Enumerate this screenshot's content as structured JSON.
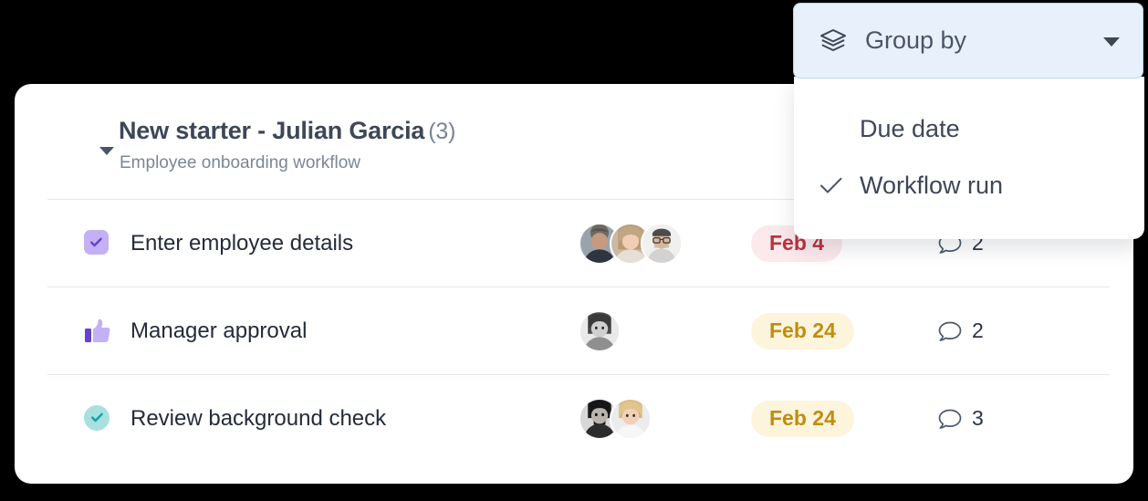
{
  "group_by_control": {
    "label": "Group by",
    "icon": "layers-icon",
    "caret_icon": "chevron-down-icon",
    "background": "#e8f1fb",
    "border": "#b9d3ee",
    "menu": {
      "items": [
        {
          "label": "Due date",
          "checked": false
        },
        {
          "label": "Workflow run",
          "checked": true
        }
      ],
      "check_icon": "check-icon"
    }
  },
  "task_group": {
    "collapse_icon": "caret-down-icon",
    "title": "New starter - Julian Garcia",
    "count": "(3)",
    "subtitle": "Employee onboarding workflow",
    "rows": [
      {
        "status_icon": "checkbox-checked-icon",
        "status_style": "purple-checkbox",
        "name": "Enter employee details",
        "avatar_count": 3,
        "due_date": "Feb 4",
        "due_style": "overdue",
        "due_bg": "#fbe9ec",
        "due_fg": "#b8333f",
        "comment_icon": "comment-icon",
        "comment_count": "2"
      },
      {
        "status_icon": "thumbs-up-icon",
        "status_style": "purple-thumb",
        "name": "Manager approval",
        "avatar_count": 1,
        "due_date": "Feb 24",
        "due_style": "upcoming",
        "due_bg": "#fdf4dc",
        "due_fg": "#bf8d11",
        "comment_icon": "comment-icon",
        "comment_count": "2"
      },
      {
        "status_icon": "check-circle-icon",
        "status_style": "teal-circle",
        "name": "Review background check",
        "avatar_count": 2,
        "due_date": "Feb 24",
        "due_style": "upcoming",
        "due_bg": "#fdf4dc",
        "due_fg": "#bf8d11",
        "comment_icon": "comment-icon",
        "comment_count": "3"
      }
    ]
  }
}
